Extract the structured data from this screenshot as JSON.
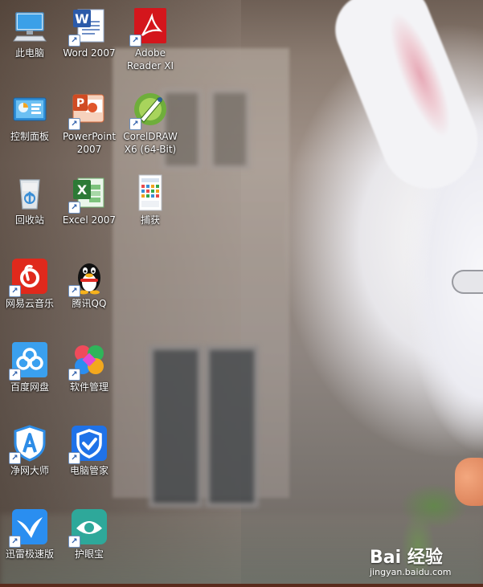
{
  "desktop": {
    "icons": [
      {
        "name": "this-pc",
        "label": "此电脑",
        "icon": "computer-icon",
        "shortcut": false
      },
      {
        "name": "word-2007",
        "label": "Word 2007",
        "icon": "word-icon",
        "shortcut": true
      },
      {
        "name": "adobe-reader",
        "label": "Adobe\nReader XI",
        "icon": "pdf-icon",
        "shortcut": true
      },
      {
        "name": "control-panel",
        "label": "控制面板",
        "icon": "control-panel-icon",
        "shortcut": false
      },
      {
        "name": "powerpoint-2007",
        "label": "PowerPoint\n2007",
        "icon": "powerpoint-icon",
        "shortcut": true
      },
      {
        "name": "coreldraw",
        "label": "CorelDRAW\nX6 (64-Bit)",
        "icon": "coreldraw-icon",
        "shortcut": true
      },
      {
        "name": "recycle-bin",
        "label": "回收站",
        "icon": "recycle-bin-icon",
        "shortcut": false
      },
      {
        "name": "excel-2007",
        "label": "Excel 2007",
        "icon": "excel-icon",
        "shortcut": true
      },
      {
        "name": "capture",
        "label": "捕获",
        "icon": "image-file-icon",
        "shortcut": false
      },
      {
        "name": "netease-music",
        "label": "网易云音乐",
        "icon": "netease-music-icon",
        "shortcut": true
      },
      {
        "name": "tencent-qq",
        "label": "腾讯QQ",
        "icon": "qq-penguin-icon",
        "shortcut": true
      },
      {
        "name": "baidu-netdisk",
        "label": "百度网盘",
        "icon": "cloud-icon",
        "shortcut": true
      },
      {
        "name": "software-manager",
        "label": "软件管理",
        "icon": "clover-icon",
        "shortcut": true
      },
      {
        "name": "jingwang-master",
        "label": "净网大师",
        "icon": "shield-a-icon",
        "shortcut": true
      },
      {
        "name": "pc-manager",
        "label": "电脑管家",
        "icon": "shield-check-icon",
        "shortcut": true
      },
      {
        "name": "xunlei",
        "label": "迅雷极速版",
        "icon": "bird-icon",
        "shortcut": true
      },
      {
        "name": "eye-protector",
        "label": "护眼宝",
        "icon": "eye-icon",
        "shortcut": true
      }
    ]
  },
  "watermark": {
    "logo": "Bai 经验",
    "sub": "jingyan.baidu.com"
  },
  "colors": {
    "word": "#2b5aa9",
    "pdf": "#d4161c",
    "excel": "#2d7a36",
    "netease": "#e0291c",
    "baidu_netdisk": "#3aa0ef",
    "pc_manager": "#1f72e8",
    "xunlei": "#2a8ef0",
    "eye": "#2ea89a"
  }
}
